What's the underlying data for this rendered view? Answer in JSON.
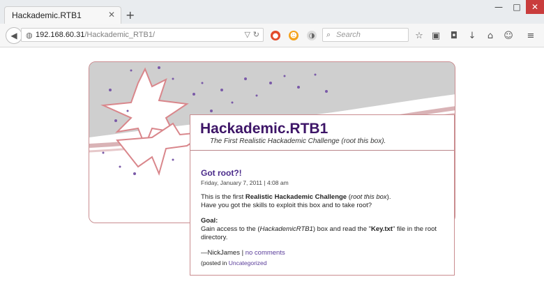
{
  "browser": {
    "tab_title": "Hackademic.RTB1",
    "tab_close": "✕",
    "new_tab": "+",
    "window_buttons": [
      "—",
      "□",
      "✕"
    ],
    "url_host": "192.168.60.31",
    "url_path": "/Hackademic_RTB1/",
    "search_placeholder": "Search",
    "icons": [
      "back-icon",
      "globe-icon",
      "dropdown-icon",
      "reload-icon",
      "addon-icons",
      "search-icon",
      "bookmark-star-icon",
      "reading-list-icon",
      "pocket-icon",
      "download-icon",
      "home-icon",
      "chat-icon",
      "menu-icon"
    ]
  },
  "site": {
    "title": "Hackademic.RTB1",
    "description": "The First Realistic Hackademic Challenge (root this box)."
  },
  "post": {
    "title": "Got root?!",
    "date": "Friday, January 7, 2011 | 4:08 am",
    "p1_a": "This is the first ",
    "p1_b": "Realistic Hackademic Challenge",
    "p1_c": " (",
    "p1_d": "root this box",
    "p1_e": ").",
    "p2": "Have you got the skills to exploit this box and to take root?",
    "goal_label": "Goal:",
    "goal_a": "Gain access to the (",
    "goal_b": "HackademicRTB1",
    "goal_c": ") box and read the \"",
    "goal_d": "Key.txt",
    "goal_e": "\" file in the root directory.",
    "author": "—NickJames",
    "sep": " | ",
    "comments": "no comments",
    "posted_prefix": "(posted in ",
    "category": "Uncategorized"
  }
}
